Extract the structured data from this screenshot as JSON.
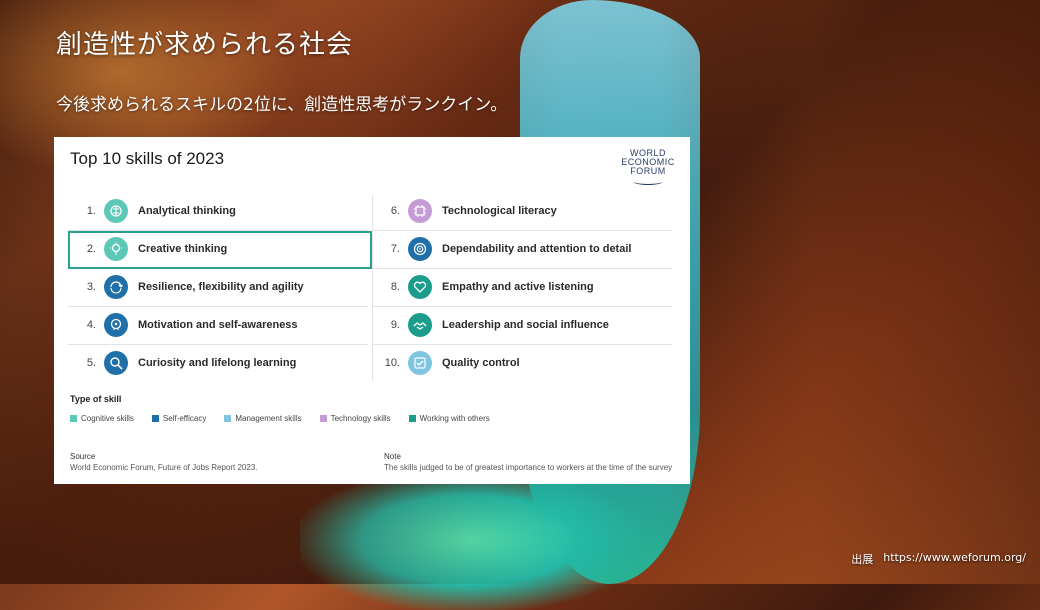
{
  "slide": {
    "title": "創造性が求められる社会",
    "subtitle": "今後求められるスキルの2位に、創造性思考がランクイン。",
    "credit_label": "出展",
    "credit_url": "https://www.weforum.org/"
  },
  "card": {
    "title": "Top 10 skills of 2023",
    "logo_lines": [
      "WORLD",
      "ECONOMIC",
      "FORUM"
    ],
    "skills": [
      {
        "num": "1.",
        "label": "Analytical thinking",
        "type": "cognitive",
        "icon": "brain-icon"
      },
      {
        "num": "2.",
        "label": "Creative thinking",
        "type": "cognitive",
        "icon": "lightbulb-icon"
      },
      {
        "num": "3.",
        "label": "Resilience, flexibility and agility",
        "type": "self-efficacy",
        "icon": "arrows-icon"
      },
      {
        "num": "4.",
        "label": "Motivation and self-awareness",
        "type": "self-efficacy",
        "icon": "head-icon"
      },
      {
        "num": "5.",
        "label": "Curiosity and lifelong learning",
        "type": "self-efficacy",
        "icon": "magnifier-icon"
      },
      {
        "num": "6.",
        "label": "Technological literacy",
        "type": "technology",
        "icon": "chip-icon"
      },
      {
        "num": "7.",
        "label": "Dependability and attention to detail",
        "type": "self-efficacy",
        "icon": "target-icon"
      },
      {
        "num": "8.",
        "label": "Empathy and active listening",
        "type": "working-with-others",
        "icon": "heart-icon"
      },
      {
        "num": "9.",
        "label": "Leadership and social influence",
        "type": "working-with-others",
        "icon": "handshake-icon"
      },
      {
        "num": "10.",
        "label": "Quality control",
        "type": "management",
        "icon": "checklist-icon"
      }
    ],
    "highlighted_rank": 2,
    "type_title": "Type of skill",
    "legend": [
      {
        "label": "Cognitive skills",
        "color": "#5cc8b8"
      },
      {
        "label": "Self-efficacy",
        "color": "#1f6fa8"
      },
      {
        "label": "Management skills",
        "color": "#7fc4e0"
      },
      {
        "label": "Technology skills",
        "color": "#c49bd4"
      },
      {
        "label": "Working with others",
        "color": "#1c9c8a"
      }
    ],
    "source_head": "Source",
    "source_text": "World Economic Forum, Future of Jobs Report 2023.",
    "note_head": "Note",
    "note_text": "The skills judged to be of greatest importance to workers at the time of the survey"
  },
  "type_colors": {
    "cognitive": "#5cc8b8",
    "self-efficacy": "#1f6fa8",
    "management": "#7fc4e0",
    "technology": "#c49bd4",
    "working-with-others": "#1c9c8a"
  }
}
